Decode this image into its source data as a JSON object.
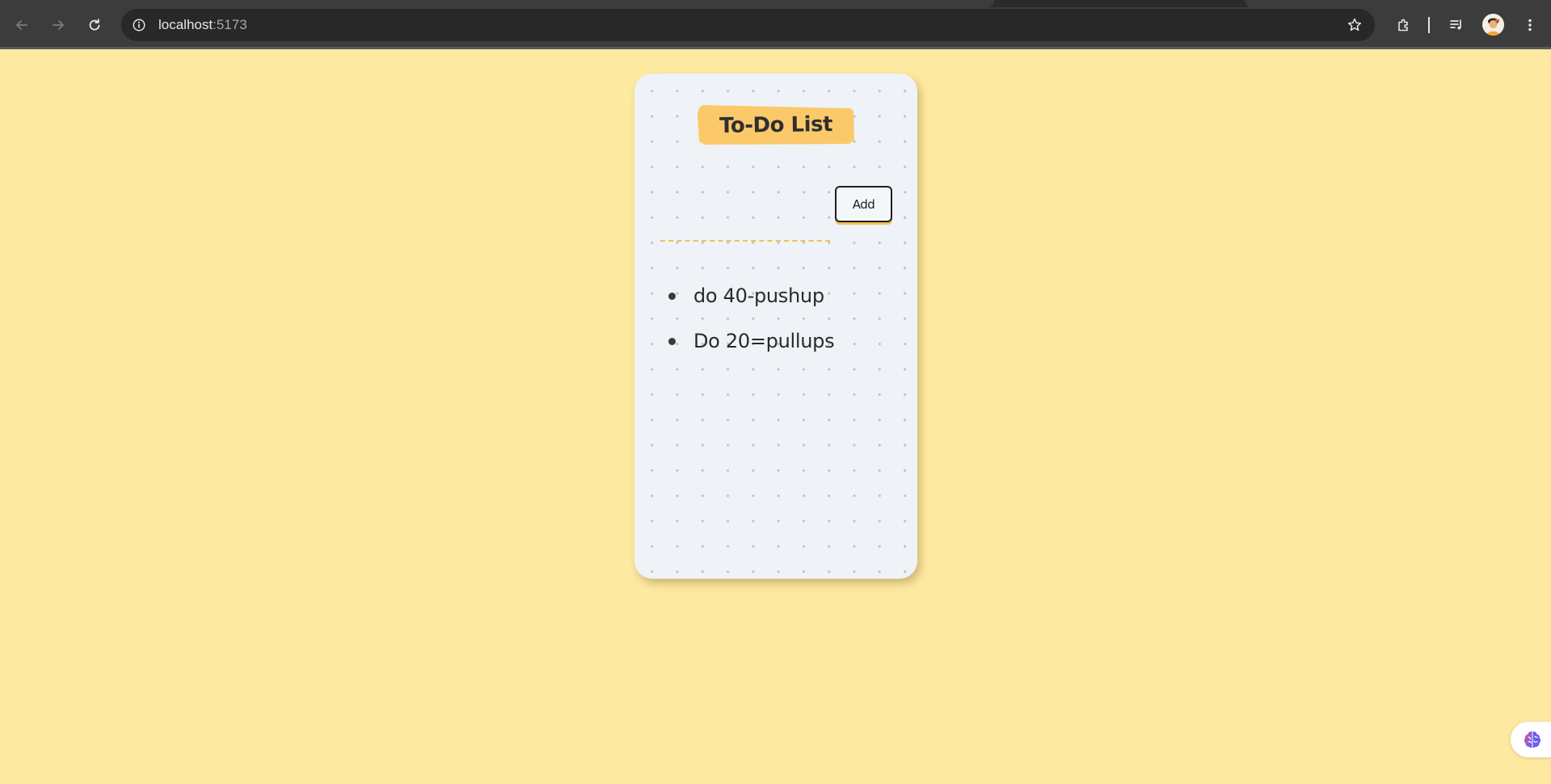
{
  "browser": {
    "url_host": "localhost",
    "url_port": ":5173",
    "icons": {
      "back": "arrow-left-icon",
      "forward": "arrow-right-icon",
      "reload": "reload-icon",
      "site_info": "info-icon",
      "bookmark": "star-icon",
      "extensions": "puzzle-icon",
      "media": "media-queue-icon",
      "profile": "avatar",
      "menu": "kebab-menu-icon"
    }
  },
  "app": {
    "title": "To-Do List",
    "input_placeholder": "",
    "add_label": "Add",
    "tasks": [
      {
        "text": "do 40-pushup"
      },
      {
        "text": "Do 20=pullups"
      }
    ]
  },
  "colors": {
    "page_background": "#fee9a1",
    "card_background": "#eff3f7",
    "accent": "#fcc96a",
    "dashed_underline": "#f3bf55",
    "text": "#2a2a2a"
  },
  "floating_widget": {
    "icon": "brain-icon"
  }
}
